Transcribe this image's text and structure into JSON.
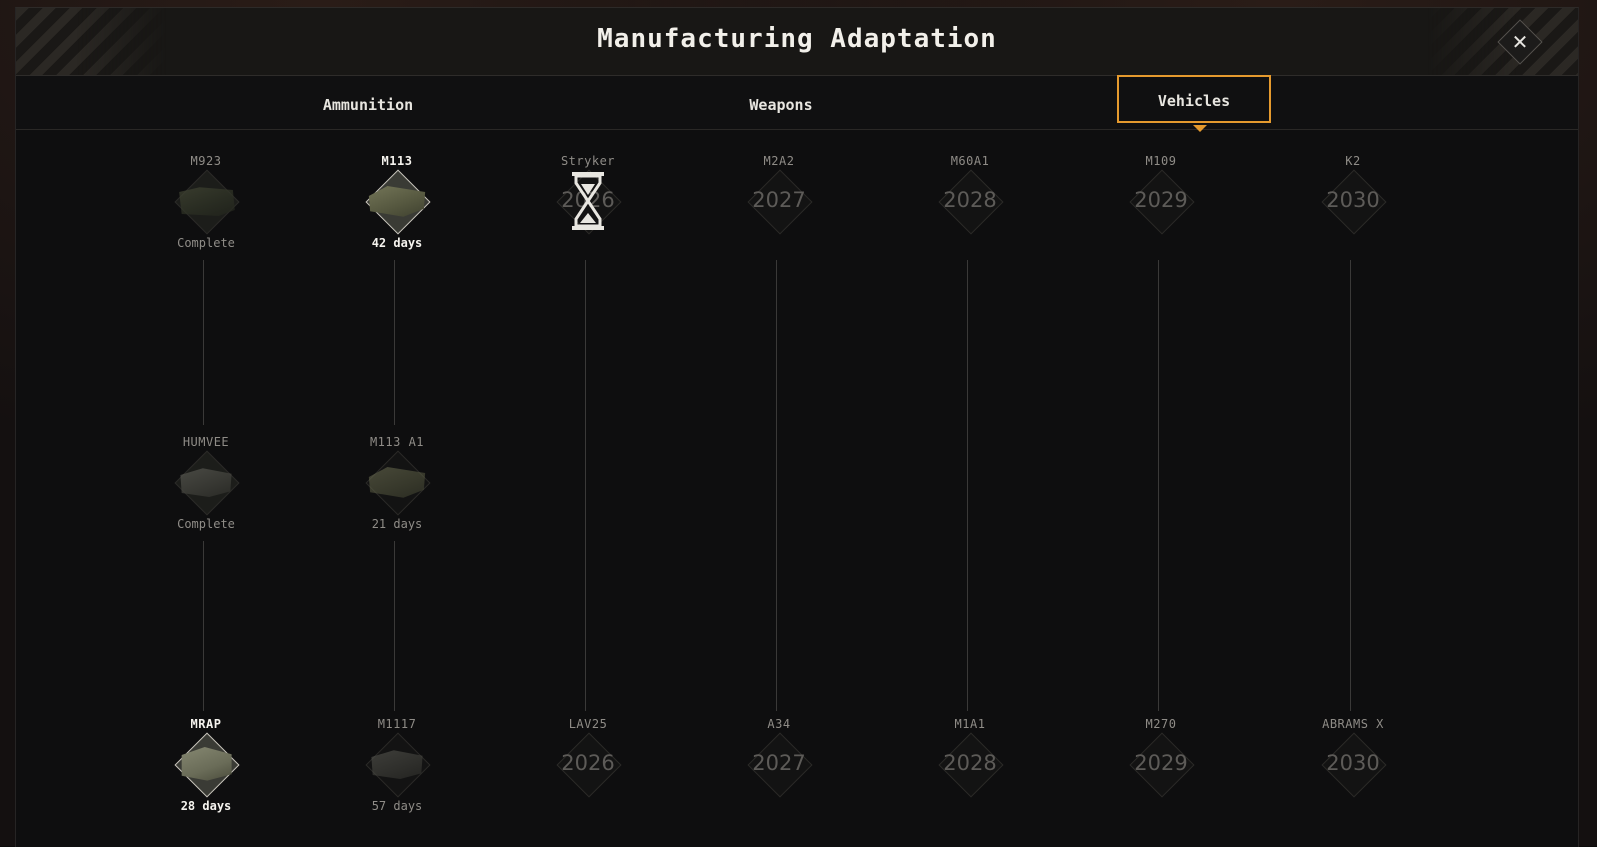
{
  "window": {
    "title": "Manufacturing Adaptation",
    "close_icon": "close-icon"
  },
  "tabs": [
    {
      "label": "Ammunition",
      "active": false
    },
    {
      "label": "Weapons",
      "active": false
    },
    {
      "label": "Vehicles",
      "active": true
    }
  ],
  "colors": {
    "accent": "#e59a2e",
    "text_bright": "#f5f3ee",
    "text_dim": "#8f8c87"
  },
  "columns": [
    {
      "top": {
        "label": "M923",
        "status": "Complete",
        "state": "complete",
        "icon": "truck"
      },
      "middle": {
        "label": "HUMVEE",
        "status": "Complete",
        "state": "complete",
        "icon": "humvee"
      },
      "bottom": {
        "label": "MRAP",
        "status": "28 days",
        "state": "selected",
        "icon": "mrap"
      }
    },
    {
      "top": {
        "label": "M113",
        "status": "42 days",
        "state": "selected",
        "icon": "apc"
      },
      "middle": {
        "label": "M113 A1",
        "status": "21 days",
        "state": "available",
        "icon": "apc"
      },
      "bottom": {
        "label": "M1117",
        "status": "57 days",
        "state": "available",
        "icon": "humvee"
      }
    },
    {
      "top": {
        "label": "Stryker",
        "year": "2026",
        "state": "in-progress",
        "icon": "hourglass-icon"
      },
      "bottom": {
        "label": "LAV25",
        "year": "2026",
        "state": "locked"
      }
    },
    {
      "top": {
        "label": "M2A2",
        "year": "2027",
        "state": "locked"
      },
      "bottom": {
        "label": "A34",
        "year": "2027",
        "state": "locked"
      }
    },
    {
      "top": {
        "label": "M60A1",
        "year": "2028",
        "state": "locked"
      },
      "bottom": {
        "label": "M1A1",
        "year": "2028",
        "state": "locked"
      }
    },
    {
      "top": {
        "label": "M109",
        "year": "2029",
        "state": "locked"
      },
      "bottom": {
        "label": "M270",
        "year": "2029",
        "state": "locked"
      }
    },
    {
      "top": {
        "label": "K2",
        "year": "2030",
        "state": "locked"
      },
      "bottom": {
        "label": "ABRAMS X",
        "year": "2030",
        "state": "locked"
      }
    }
  ]
}
